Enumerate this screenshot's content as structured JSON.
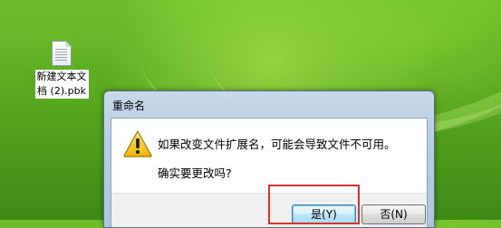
{
  "desktop": {
    "icon_label_line1": "新建文本文",
    "icon_label_line2": "档 (2).pbk",
    "icon": "text-file-icon"
  },
  "dialog": {
    "title": "重命名",
    "icon": "warning-icon",
    "message": "如果改变文件扩展名，可能会导致文件不可用。",
    "question": "确实要更改吗?",
    "buttons": {
      "yes_label": "是(Y)",
      "no_label": "否(N)"
    }
  },
  "annotation": {
    "highlight_color": "#d8342b"
  }
}
